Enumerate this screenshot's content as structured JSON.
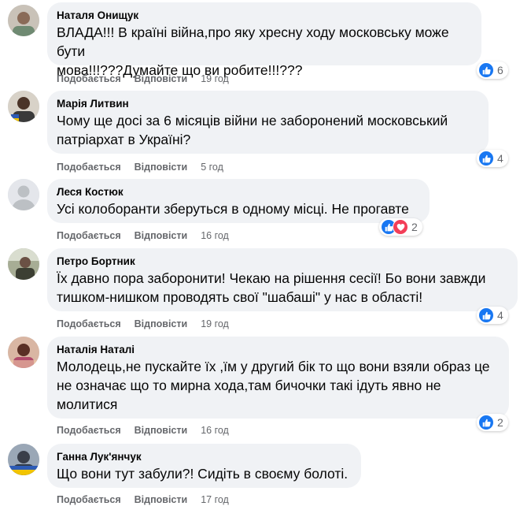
{
  "comments": [
    {
      "author": "Наталя Онищук",
      "text": "ВЛАДА!!! В країні війна,про яку хресну ходу московську може бути\nмова!!!???Думайте що ви робите!!!???",
      "like_label": "Подобається",
      "reply_label": "Відповісти",
      "time": "19 год",
      "reactions": [
        "like-icon"
      ],
      "reaction_count": "6"
    },
    {
      "author": "Марія Литвин",
      "text": "Чому ще досі за 6 місяців війни не заборонений московський\nпатріархат в Україні?",
      "like_label": "Подобається",
      "reply_label": "Відповісти",
      "time": "5 год",
      "reactions": [
        "like-icon"
      ],
      "reaction_count": "4"
    },
    {
      "author": "Леся Костюк",
      "text": "Усі колоборанти зберуться в одному місці. Не прогавте",
      "like_label": "Подобається",
      "reply_label": "Відповісти",
      "time": "16 год",
      "reactions": [
        "like-icon",
        "love-icon"
      ],
      "reaction_count": "2"
    },
    {
      "author": "Петро Бортник",
      "text": "Їх давно пора заборонити! Чекаю на рішення сесії! Бо вони завжди\nтишком-нишком проводять свої \"шабаші\" у нас в області!",
      "like_label": "Подобається",
      "reply_label": "Відповісти",
      "time": "19 год",
      "reactions": [
        "like-icon"
      ],
      "reaction_count": "4"
    },
    {
      "author": "Наталія Наталі",
      "text": "Молодець,не пускайте їх ,їм у другий бік то що вони взяли образ це\nне означає що то мирна хода,там бичочки такі ідуть явно не\nмолитися",
      "like_label": "Подобається",
      "reply_label": "Відповісти",
      "time": "16 год",
      "reactions": [
        "like-icon"
      ],
      "reaction_count": "2"
    },
    {
      "author": "Ганна Лук'янчук",
      "text": "Що вони тут забули?! Сидіть в своєму болоті.",
      "like_label": "Подобається",
      "reply_label": "Відповісти",
      "time": "17 год",
      "reactions": [],
      "reaction_count": ""
    }
  ],
  "colors": {
    "bubble": "#f0f2f5",
    "like": "#1877f2",
    "love": "#f33e58",
    "secondary_text": "#65676b"
  }
}
